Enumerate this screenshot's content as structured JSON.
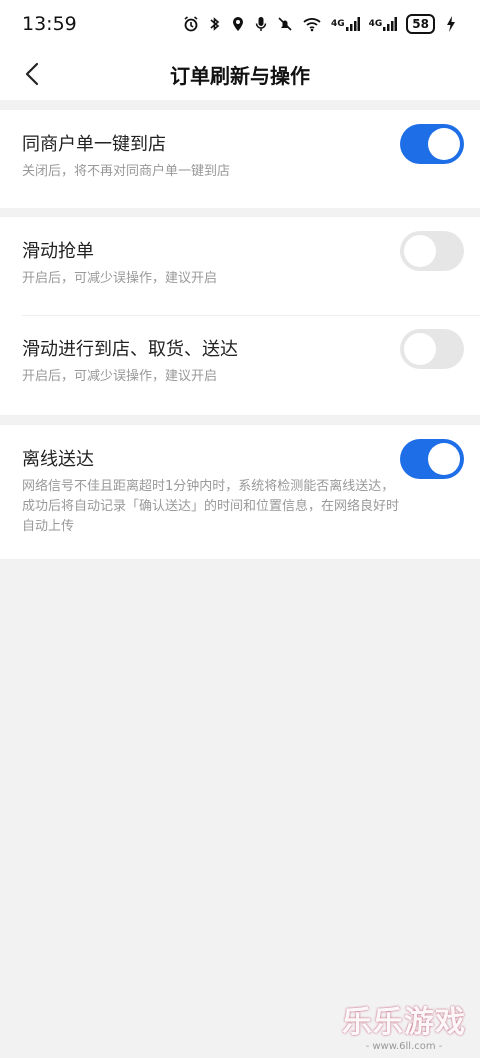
{
  "status_bar": {
    "time": "13:59",
    "battery": "58",
    "icons": [
      "alarm-icon",
      "bluetooth-icon",
      "location-icon",
      "mic-icon",
      "mute-icon",
      "wifi-icon",
      "signal-icon",
      "signal-icon",
      "charging-icon"
    ],
    "network_labels": [
      "4G",
      "4G"
    ]
  },
  "nav": {
    "title": "订单刷新与操作"
  },
  "settings": {
    "same_merchant": {
      "title": "同商户单一键到店",
      "desc": "关闭后，将不再对同商户单一键到店",
      "enabled": true
    },
    "swipe_grab": {
      "title": "滑动抢单",
      "desc": "开启后，可减少误操作，建议开启",
      "enabled": false
    },
    "swipe_progress": {
      "title": "滑动进行到店、取货、送达",
      "desc": "开启后，可减少误操作，建议开启",
      "enabled": false
    },
    "offline_delivery": {
      "title": "离线送达",
      "desc": "网络信号不佳且距离超时1分钟内时，系统将检测能否离线送达，成功后将自动记录「确认送达」的时间和位置信息，在网络良好时自动上传",
      "enabled": true
    }
  },
  "colors": {
    "toggle_on": "#1e6ee8",
    "toggle_off": "#e6e6e6"
  },
  "watermark": {
    "logo": "乐乐游戏",
    "url": "- www.6ll.com -"
  }
}
